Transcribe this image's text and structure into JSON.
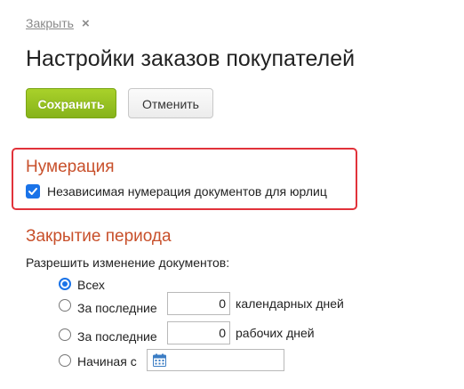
{
  "header": {
    "close_label": "Закрыть",
    "close_icon": "×",
    "title": "Настройки заказов покупателей"
  },
  "toolbar": {
    "save_label": "Сохранить",
    "cancel_label": "Отменить"
  },
  "numbering": {
    "title": "Нумерация",
    "checkbox_label": "Независимая нумерация документов для юрлиц",
    "checked": true
  },
  "period": {
    "title": "Закрытие периода",
    "permission_label": "Разрешить изменение документов:",
    "options": [
      {
        "label": "Всех",
        "selected": true
      },
      {
        "label": "За последние",
        "value": "0",
        "unit": "календарных дней",
        "selected": false
      },
      {
        "label": "За последние",
        "value": "0",
        "unit": "рабочих дней",
        "selected": false
      },
      {
        "label": "Начиная с",
        "date_value": "",
        "selected": false
      }
    ]
  },
  "colors": {
    "accent_green": "#8dbb1d",
    "section_title": "#c8502b",
    "highlight_border": "#e1323a",
    "checkbox_blue": "#1a73e8"
  }
}
